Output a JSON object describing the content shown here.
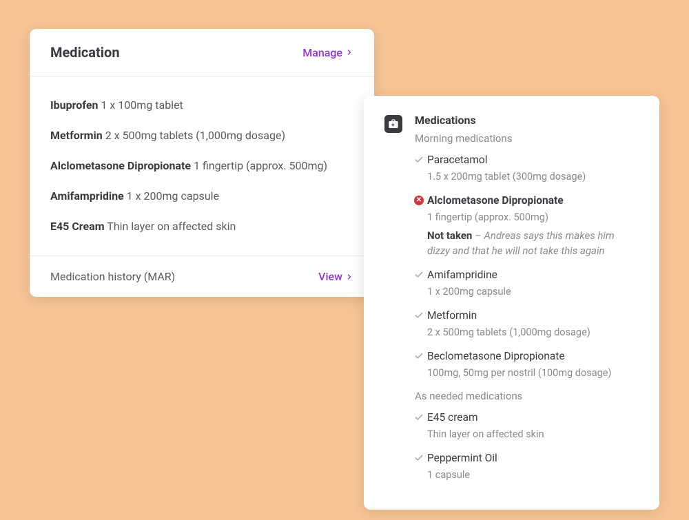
{
  "left_card": {
    "title": "Medication",
    "manage_label": "Manage",
    "footer_label": "Medication history (MAR)",
    "view_label": "View",
    "items": [
      {
        "name": "Ibuprofen",
        "dose": "1 x 100mg tablet"
      },
      {
        "name": "Metformin",
        "dose": "2 x 500mg tablets (1,000mg dosage)"
      },
      {
        "name": "Alclometasone Dipropionate",
        "dose": "1 fingertip (approx. 500mg)"
      },
      {
        "name": "Amifampridine",
        "dose": "1 x 200mg capsule"
      },
      {
        "name": "E45 Cream",
        "dose": "Thin layer on affected skin"
      }
    ]
  },
  "right_card": {
    "title": "Medications",
    "morning_label": "Morning medications",
    "asneeded_label": "As needed medications",
    "morning": [
      {
        "status": "taken",
        "name": "Paracetamol",
        "dose": "1.5 x 200mg tablet (300mg dosage)"
      },
      {
        "status": "not_taken",
        "name": "Alclometasone Dipropionate",
        "dose": "1 fingertip (approx. 500mg)",
        "not_taken_label": "Not taken",
        "note_sep": " – ",
        "note": "Andreas says this makes him dizzy and that he will not take this again"
      },
      {
        "status": "taken",
        "name": "Amifampridine",
        "dose": "1 x 200mg capsule"
      },
      {
        "status": "taken",
        "name": "Metformin",
        "dose": "2 x 500mg tablets (1,000mg dosage)"
      },
      {
        "status": "taken",
        "name": "Beclometasone Dipropionate",
        "dose": "100mg, 50mg per nostril (100mg dosage)"
      }
    ],
    "asneeded": [
      {
        "status": "taken",
        "name": "E45 cream",
        "dose": "Thin layer on affected skin"
      },
      {
        "status": "taken",
        "name": "Peppermint Oil",
        "dose": "1 capsule"
      }
    ]
  },
  "colors": {
    "background": "#f7c594",
    "accent": "#9038d6",
    "error": "#d63636",
    "text": "#3a3a3f",
    "muted": "#8a8a8f"
  }
}
